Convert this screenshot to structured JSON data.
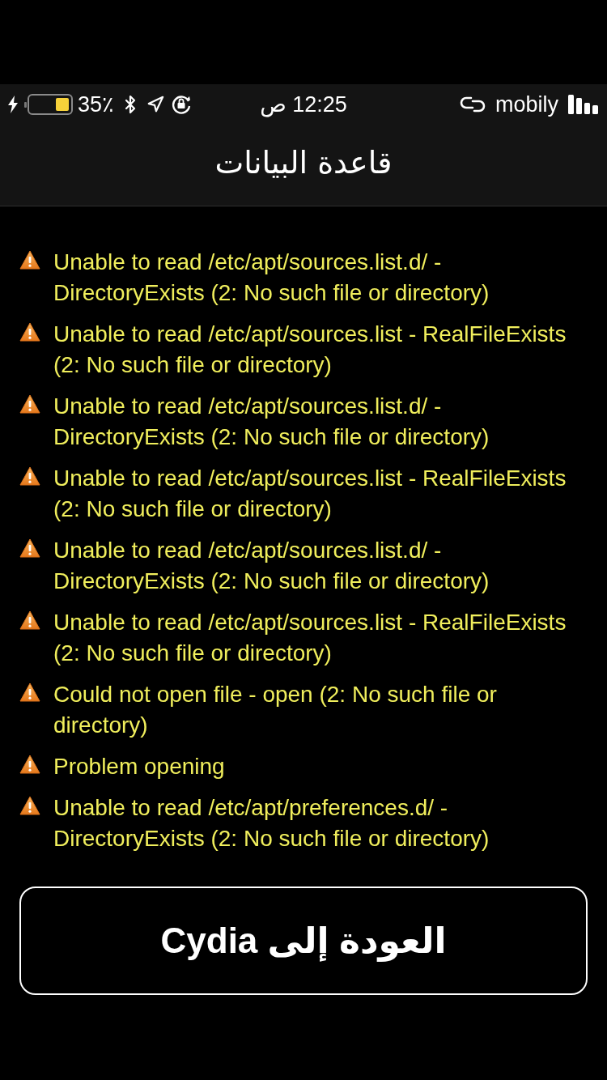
{
  "status_bar": {
    "battery_percent": "35٪",
    "time": "12:25 ص",
    "carrier": "mobily"
  },
  "nav_bar": {
    "title": "قاعدة البيانات"
  },
  "messages": [
    {
      "text": "Unable to read /etc/apt/sources.list.d/ - DirectoryExists (2: No such file or directory)"
    },
    {
      "text": "Unable to read /etc/apt/sources.list - RealFileExists (2: No such file or directory)"
    },
    {
      "text": "Unable to read /etc/apt/sources.list.d/ - DirectoryExists (2: No such file or directory)"
    },
    {
      "text": "Unable to read /etc/apt/sources.list - RealFileExists (2: No such file or directory)"
    },
    {
      "text": "Unable to read /etc/apt/sources.list.d/ - DirectoryExists (2: No such file or directory)"
    },
    {
      "text": "Unable to read /etc/apt/sources.list - RealFileExists (2: No such file or directory)"
    },
    {
      "text": "Could not open file - open (2: No such file or directory)"
    },
    {
      "text": "Problem opening"
    },
    {
      "text": "Unable to read /etc/apt/preferences.d/ - DirectoryExists (2: No such file or directory)"
    }
  ],
  "button": {
    "label": "العودة إلى Cydia"
  }
}
